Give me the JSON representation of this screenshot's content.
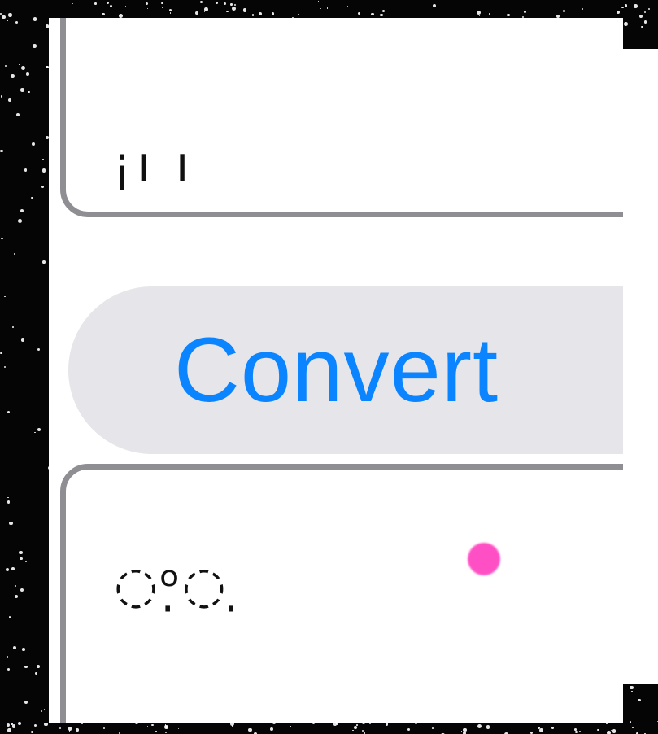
{
  "input": {
    "text": "¡ı ı"
  },
  "convert_button": {
    "label": "Convert"
  },
  "output": {
    "text": "◌ᵒ̣◌ ̣"
  },
  "colors": {
    "accent": "#0a84ff",
    "button_bg": "#e5e5ea",
    "card_border": "#8e8e93",
    "touch_indicator": "#ff4fc4"
  }
}
